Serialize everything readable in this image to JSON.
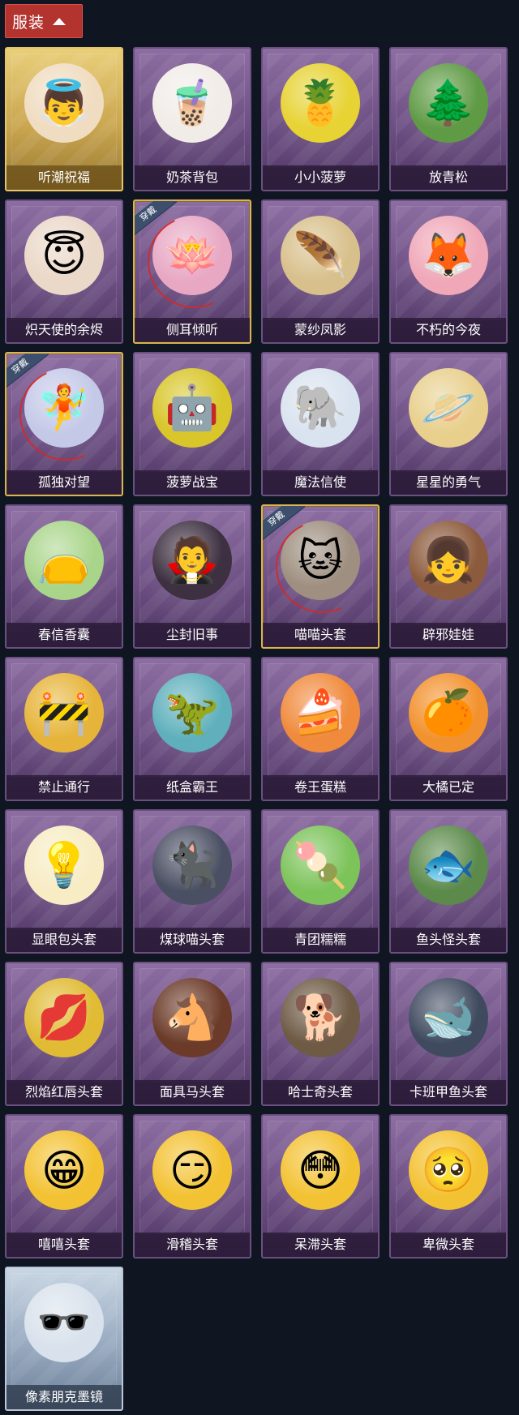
{
  "section": {
    "title": "服装"
  },
  "items": [
    {
      "name": "听潮祝福",
      "style": "gold",
      "art": "👼",
      "art_bg": "#f0dcc0",
      "equipped": false
    },
    {
      "name": "奶茶背包",
      "style": "purple",
      "art": "🧋",
      "art_bg": "#f1ece8",
      "equipped": false
    },
    {
      "name": "小小菠萝",
      "style": "purple",
      "art": "🍍",
      "art_bg": "#e7d334",
      "equipped": false
    },
    {
      "name": "放青松",
      "style": "purple",
      "art": "🌲",
      "art_bg": "#5f9a45",
      "equipped": false
    },
    {
      "name": "炽天使的余烬",
      "style": "purple",
      "art": "😇",
      "art_bg": "#ead8c8",
      "equipped": false
    },
    {
      "name": "侧耳倾听",
      "style": "purple",
      "art": "🪷",
      "art_bg": "#e8a8c4",
      "equipped": true
    },
    {
      "name": "蒙纱凤影",
      "style": "purple",
      "art": "🪶",
      "art_bg": "#d8c08c",
      "equipped": false
    },
    {
      "name": "不朽的今夜",
      "style": "purple",
      "art": "🦊",
      "art_bg": "#f0a8b8",
      "equipped": false
    },
    {
      "name": "孤独对望",
      "style": "purple",
      "art": "🧚",
      "art_bg": "#c4c9e8",
      "equipped": true
    },
    {
      "name": "菠萝战宝",
      "style": "purple",
      "art": "🤖",
      "art_bg": "#d8c62a",
      "equipped": false
    },
    {
      "name": "魔法信使",
      "style": "purple",
      "art": "🐘",
      "art_bg": "#d9e3ef",
      "equipped": false
    },
    {
      "name": "星星的勇气",
      "style": "purple",
      "art": "🪐",
      "art_bg": "#e8cf8c",
      "equipped": false
    },
    {
      "name": "春信香囊",
      "style": "purple",
      "art": "👝",
      "art_bg": "#a9d58a",
      "equipped": false
    },
    {
      "name": "尘封旧事",
      "style": "purple",
      "art": "🧛",
      "art_bg": "#3d3040",
      "equipped": false
    },
    {
      "name": "喵喵头套",
      "style": "purple",
      "art": "🐱",
      "art_bg": "#9e8f80",
      "equipped": true
    },
    {
      "name": "辟邪娃娃",
      "style": "purple",
      "art": "👧",
      "art_bg": "#8c5a3c",
      "equipped": false
    },
    {
      "name": "禁止通行",
      "style": "purple",
      "art": "🚧",
      "art_bg": "#e6b43a",
      "equipped": false
    },
    {
      "name": "纸盒霸王",
      "style": "purple",
      "art": "🦖",
      "art_bg": "#5fb0bc",
      "equipped": false
    },
    {
      "name": "卷王蛋糕",
      "style": "purple",
      "art": "🍰",
      "art_bg": "#f08a3c",
      "equipped": false
    },
    {
      "name": "大橘已定",
      "style": "purple",
      "art": "🍊",
      "art_bg": "#f2922e",
      "equipped": false
    },
    {
      "name": "显眼包头套",
      "style": "purple",
      "art": "💡",
      "art_bg": "#f7ecc4",
      "equipped": false
    },
    {
      "name": "煤球喵头套",
      "style": "purple",
      "art": "🐈‍⬛",
      "art_bg": "#4a4f63",
      "equipped": false
    },
    {
      "name": "青团糯糯",
      "style": "purple",
      "art": "🍡",
      "art_bg": "#7cc35a",
      "equipped": false
    },
    {
      "name": "鱼头怪头套",
      "style": "purple",
      "art": "🐟",
      "art_bg": "#5b8a4a",
      "equipped": false
    },
    {
      "name": "烈焰红唇头套",
      "style": "purple",
      "art": "💋",
      "art_bg": "#e0bb33",
      "equipped": false
    },
    {
      "name": "面具马头套",
      "style": "purple",
      "art": "🐴",
      "art_bg": "#6b3a28",
      "equipped": false
    },
    {
      "name": "哈士奇头套",
      "style": "purple",
      "art": "🐕",
      "art_bg": "#6e5a45",
      "equipped": false
    },
    {
      "name": "卡班甲鱼头套",
      "style": "purple",
      "art": "🐋",
      "art_bg": "#3f4a5f",
      "equipped": false
    },
    {
      "name": "嘻嘻头套",
      "style": "purple",
      "art": "😁",
      "art_bg": "#f3c233",
      "equipped": false
    },
    {
      "name": "滑稽头套",
      "style": "purple",
      "art": "😏",
      "art_bg": "#f3c233",
      "equipped": false
    },
    {
      "name": "呆滞头套",
      "style": "purple",
      "art": "😳",
      "art_bg": "#f3c233",
      "equipped": false
    },
    {
      "name": "卑微头套",
      "style": "purple",
      "art": "🥺",
      "art_bg": "#f3c233",
      "equipped": false
    },
    {
      "name": "像素朋克墨镜",
      "style": "silver",
      "art": "🕶️",
      "art_bg": "#d9e2ec",
      "equipped": false
    }
  ],
  "equipped_label": "穿戴"
}
